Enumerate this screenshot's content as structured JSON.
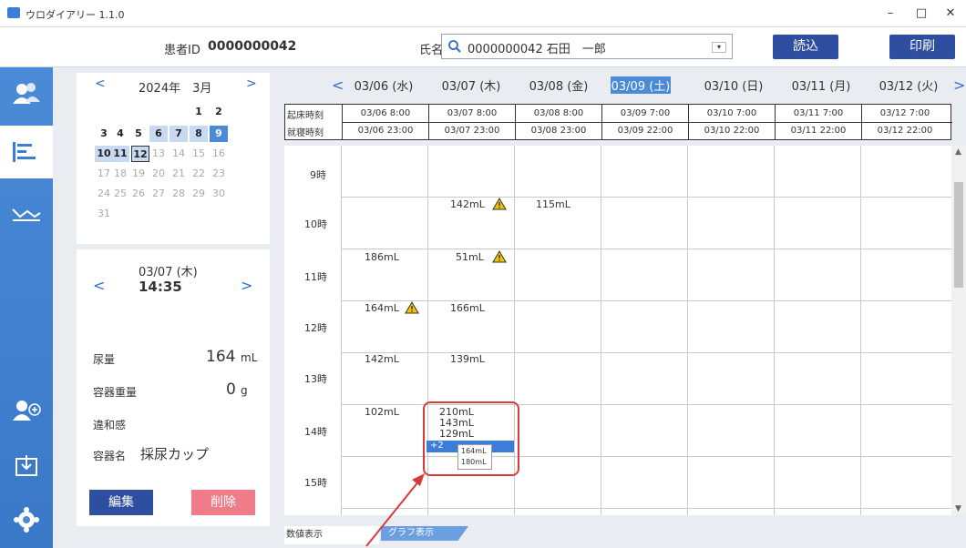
{
  "window": {
    "title": "ウロダイアリー 1.1.0",
    "min": "–",
    "max": "□",
    "close": "✕"
  },
  "header": {
    "patient_id_label": "患者ID",
    "patient_id_value": "0000000042",
    "name_label": "氏名",
    "name_value": "0000000042 石田　一郎",
    "read_label": "読込",
    "print_label": "印刷"
  },
  "calendar": {
    "prev": "<",
    "next": ">",
    "month_label": "2024年　3月",
    "days": [
      "1",
      "2",
      "3",
      "4",
      "5",
      "6",
      "7",
      "8",
      "9",
      "10",
      "11",
      "12",
      "13",
      "14",
      "15",
      "16",
      "17",
      "18",
      "19",
      "20",
      "21",
      "22",
      "23",
      "24",
      "25",
      "26",
      "27",
      "28",
      "29",
      "30",
      "31"
    ]
  },
  "detail": {
    "prev": "<",
    "next": ">",
    "date": "03/07 (木)",
    "time": "14:35",
    "urine_label": "尿量",
    "urine_value": "164",
    "urine_unit": "mL",
    "container_weight_label": "容器重量",
    "container_weight_value": "0",
    "container_weight_unit": "g",
    "discomfort_label": "違和感",
    "container_name_label": "容器名",
    "container_name_value": "採尿カップ",
    "edit_label": "編集",
    "delete_label": "削除"
  },
  "dates": {
    "prev": "<",
    "next": ">",
    "items": [
      "03/06 (水)",
      "03/07 (木)",
      "03/08 (金)",
      "03/09 (土)",
      "03/10 (日)",
      "03/11 (月)",
      "03/12 (火)"
    ],
    "selected_index": 3
  },
  "sleep": {
    "wake_label": "起床時刻",
    "sleep_label": "就寝時刻",
    "wake": [
      "03/06 8:00",
      "03/07 8:00",
      "03/08 8:00",
      "03/09 7:00",
      "03/10 7:00",
      "03/11 7:00",
      "03/12 7:00"
    ],
    "bed": [
      "03/06 23:00",
      "03/07 23:00",
      "03/08 23:00",
      "03/09 22:00",
      "03/10 22:00",
      "03/11 22:00",
      "03/12 22:00"
    ]
  },
  "hours": [
    "9時",
    "10時",
    "11時",
    "12時",
    "13時",
    "14時",
    "15時"
  ],
  "volumes": {
    "d07_10": "142mL",
    "d08_10": "115mL",
    "d06_11": "186mL",
    "d07_11": "51mL",
    "d06_12": "164mL",
    "d07_12": "166mL",
    "d06_13": "142mL",
    "d07_13": "139mL",
    "d06_14": "102mL",
    "d07_14a": "210mL",
    "d07_14b": "143mL",
    "d07_14c": "129mL",
    "more_badge": "+2",
    "popup_a": "164mL",
    "popup_b": "180mL"
  },
  "tabs": {
    "numeric": "数値表示",
    "graph": "グラフ表示"
  },
  "colors": {
    "accent": "#2e4fa0",
    "rail": "#4a8ad6",
    "delete": "#f07c8a",
    "highlight": "#d83a3a",
    "warning": "#f2c200"
  }
}
